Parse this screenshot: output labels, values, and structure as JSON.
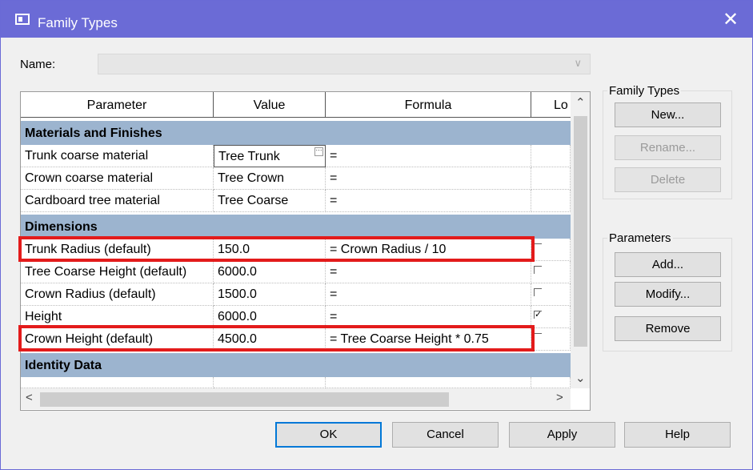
{
  "window": {
    "title": "Family Types",
    "icon": "family-types-icon",
    "close_glyph": "✕"
  },
  "name_field": {
    "label": "Name:",
    "value": ""
  },
  "table": {
    "columns": [
      "Parameter",
      "Value",
      "Formula",
      "Lo"
    ],
    "groups": [
      {
        "title": "Materials and Finishes",
        "rows": [
          {
            "parameter": "Trunk coarse material",
            "value": "Tree Trunk",
            "formula": "=",
            "lock": ""
          },
          {
            "parameter": "Crown coarse material",
            "value": "Tree Crown",
            "formula": "=",
            "lock": ""
          },
          {
            "parameter": "Cardboard tree material",
            "value": "Tree Coarse",
            "formula": "=",
            "lock": ""
          }
        ]
      },
      {
        "title": "Dimensions",
        "rows": [
          {
            "parameter": "Trunk Radius (default)",
            "value": "150.0",
            "formula": "= Crown Radius / 10",
            "lock": "unchecked"
          },
          {
            "parameter": "Tree Coarse Height (default)",
            "value": "6000.0",
            "formula": "=",
            "lock": "unchecked"
          },
          {
            "parameter": "Crown Radius (default)",
            "value": "1500.0",
            "formula": "=",
            "lock": "unchecked"
          },
          {
            "parameter": "Height",
            "value": "6000.0",
            "formula": "=",
            "lock": "checked"
          },
          {
            "parameter": "Crown Height (default)",
            "value": "4500.0",
            "formula": "= Tree Coarse Height * 0.75",
            "lock": "unchecked"
          }
        ]
      },
      {
        "title": "Identity Data",
        "rows": []
      }
    ]
  },
  "family_types_panel": {
    "title": "Family Types",
    "buttons": {
      "new": "New...",
      "rename": "Rename...",
      "delete": "Delete"
    }
  },
  "parameters_panel": {
    "title": "Parameters",
    "buttons": {
      "add": "Add...",
      "modify": "Modify...",
      "remove": "Remove"
    }
  },
  "footer": {
    "ok": "OK",
    "cancel": "Cancel",
    "apply": "Apply",
    "help": "Help"
  },
  "colors": {
    "titlebar": "#6b6bd6",
    "group_header": "#9cb4cf",
    "highlight": "#e31b1b"
  }
}
